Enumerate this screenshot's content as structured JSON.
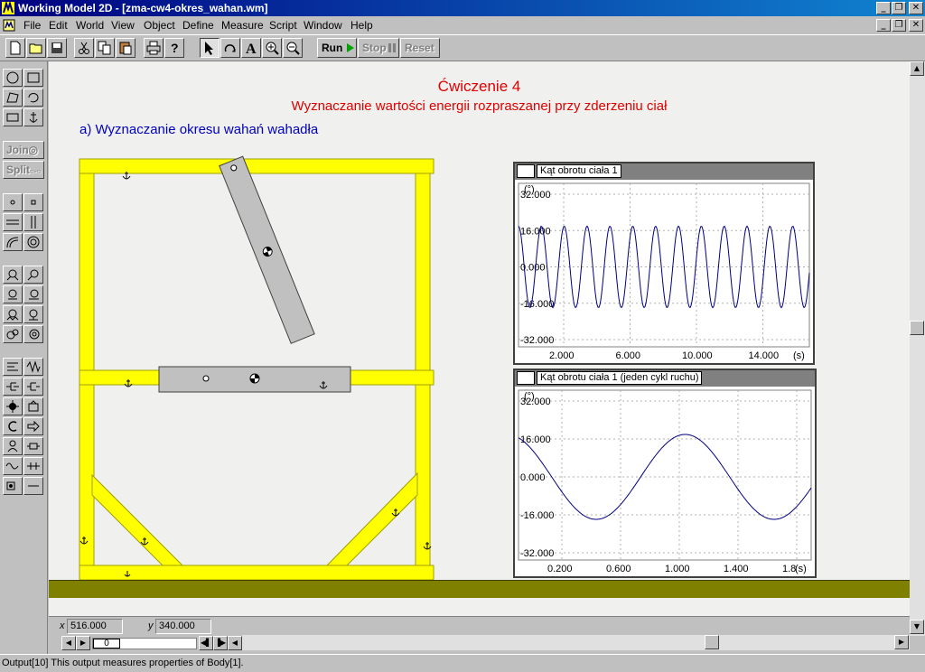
{
  "window": {
    "app_name": "Working Model 2D",
    "document": "[zma-cw4-okres_wahan.wm]",
    "title": "Working Model 2D - [zma-cw4-okres_wahan.wm]"
  },
  "menu": {
    "items": [
      {
        "label": "File",
        "key": "F"
      },
      {
        "label": "Edit",
        "key": "E"
      },
      {
        "label": "World",
        "key": "W"
      },
      {
        "label": "View",
        "key": "V"
      },
      {
        "label": "Object",
        "key": "O"
      },
      {
        "label": "Define",
        "key": "D"
      },
      {
        "label": "Measure",
        "key": "M"
      },
      {
        "label": "Script",
        "key": "S"
      },
      {
        "label": "Window",
        "key": "W"
      },
      {
        "label": "Help",
        "key": "H"
      }
    ]
  },
  "toolbar": {
    "run_label": "Run",
    "stop_label": "Stop",
    "reset_label": "Reset",
    "tools": [
      "new-icon",
      "open-icon",
      "save-icon",
      "cut-icon",
      "copy-icon",
      "paste-icon",
      "print-icon",
      "help-icon",
      "pointer-icon",
      "rotate-icon",
      "text-icon",
      "zoom-in-icon",
      "zoom-out-icon"
    ]
  },
  "palette": {
    "join_label": "Join",
    "split_label": "Split"
  },
  "canvas": {
    "heading": "Ćwiczenie 4",
    "subheading": "Wyznaczanie wartości energii rozpraszanej przy zderzeniu ciał",
    "section": "a) Wyznaczanie okresu wahań wahadła"
  },
  "meters": [
    {
      "title": "Kąt obrotu ciała 1",
      "unit_y": "(°)",
      "unit_x": "(s)",
      "y_ticks": [
        "32.000",
        "16.000",
        "0.000",
        "-16.000",
        "-32.000"
      ],
      "x_ticks": [
        "2.000",
        "6.000",
        "10.000",
        "14.000"
      ]
    },
    {
      "title": "Kąt obrotu ciała 1 (jeden cykl ruchu)",
      "unit_y": "(°)",
      "unit_x": "(s)",
      "y_ticks": [
        "32.000",
        "16.000",
        "0.000",
        "-16.000",
        "-32.000"
      ],
      "x_ticks": [
        "0.200",
        "0.600",
        "1.000",
        "1.400",
        "1.8"
      ]
    }
  ],
  "coords": {
    "x_label": "x",
    "x_value": "516.000",
    "y_label": "y",
    "y_value": "340.000"
  },
  "frame": {
    "value": "0"
  },
  "status": {
    "text": "Output[10]   This output measures properties of Body[1]."
  },
  "colors": {
    "frame_yellow": "#ffff00",
    "ground": "#7f7f00",
    "heading_red": "#e00000",
    "section_blue": "#0000c0",
    "trace": "#000080"
  }
}
